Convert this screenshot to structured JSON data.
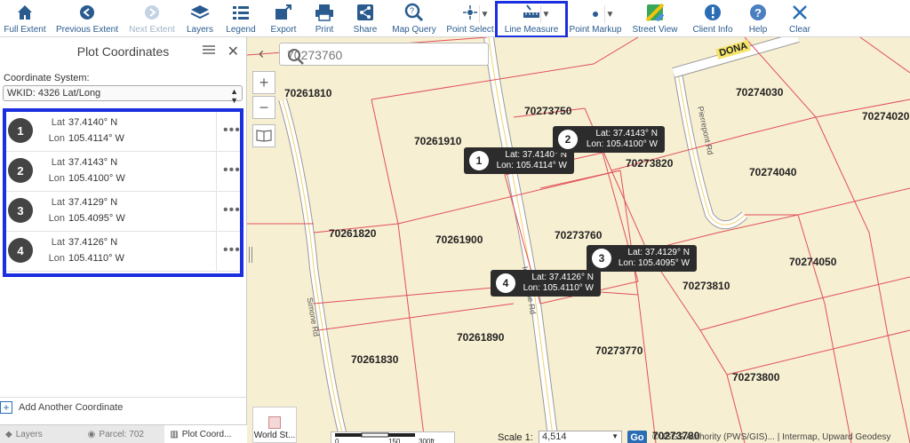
{
  "toolbar": {
    "items": [
      {
        "label": "Full Extent",
        "icon": "home-icon"
      },
      {
        "label": "Previous Extent",
        "icon": "back-arrow-icon"
      },
      {
        "label": "Next Extent",
        "icon": "forward-arrow-icon"
      },
      {
        "label": "Layers",
        "icon": "layers-icon"
      },
      {
        "label": "Legend",
        "icon": "legend-icon"
      },
      {
        "label": "Export",
        "icon": "export-icon"
      },
      {
        "label": "Print",
        "icon": "printer-icon"
      },
      {
        "label": "Share",
        "icon": "share-icon"
      },
      {
        "label": "Map Query",
        "icon": "magnifier-icon"
      },
      {
        "label": "Point Select",
        "icon": "point-select-icon"
      },
      {
        "label": "Line Measure",
        "icon": "ruler-icon"
      },
      {
        "label": "Point Markup",
        "icon": "point-markup-icon"
      },
      {
        "label": "Street View",
        "icon": "street-view-icon"
      },
      {
        "label": "Client Info",
        "icon": "info-icon"
      },
      {
        "label": "Help",
        "icon": "help-icon"
      },
      {
        "label": "Clear",
        "icon": "close-x-icon"
      }
    ],
    "accent": "#2a5b8f",
    "highlight_color": "#1a2fe0"
  },
  "panel": {
    "title": "Plot Coordinates",
    "coord_system_label": "Coordinate System:",
    "coord_system_value": "WKID: 4326 Lat/Long",
    "lat_label": "Lat",
    "lon_label": "Lon",
    "coords": [
      {
        "num": "1",
        "lat": "37.4140° N",
        "lon": "105.4114° W"
      },
      {
        "num": "2",
        "lat": "37.4143° N",
        "lon": "105.4100° W"
      },
      {
        "num": "3",
        "lat": "37.4129° N",
        "lon": "105.4095° W"
      },
      {
        "num": "4",
        "lat": "37.4126° N",
        "lon": "105.4110° W"
      }
    ],
    "more_glyph": "•••",
    "add_label": "Add Another Coordinate",
    "tabs": [
      "Layers",
      "Parcel: 702",
      "Plot Coord..."
    ]
  },
  "map": {
    "search_value": "70273760",
    "parcels": [
      "70261810",
      "70273750",
      "70274030",
      "70274020",
      "70261910",
      "70273820",
      "70274040",
      "70261820",
      "70261900",
      "70273760",
      "70274050",
      "70273810",
      "70261890",
      "70273770",
      "70261830",
      "70273800",
      "70273780"
    ],
    "roads": [
      "Pierrepont Rd",
      "Ice House Rd",
      "Simone Rd",
      "DONA"
    ],
    "callouts": [
      {
        "num": "1",
        "lat": "Lat: 37.4140° N",
        "lon": "Lon: 105.4114° W"
      },
      {
        "num": "2",
        "lat": "Lat: 37.4143° N",
        "lon": "Lon: 105.4100° W"
      },
      {
        "num": "3",
        "lat": "Lat: 37.4129° N",
        "lon": "Lon: 105.4095° W"
      },
      {
        "num": "4",
        "lat": "Lat: 37.4126° N",
        "lon": "Lon: 105.4110° W"
      }
    ],
    "basemap_label": "World St...",
    "scale_ticks": [
      "0",
      "150",
      "300ft"
    ],
    "scale_label": "Scale 1:",
    "scale_value": "4,514",
    "go_label": "Go",
    "attribution": "©USGS Authority (PWS/GIS)... | Intermap, Upward Geodesy",
    "parcel_fill": "#f7efd2",
    "parcel_line": "#e0505a"
  }
}
